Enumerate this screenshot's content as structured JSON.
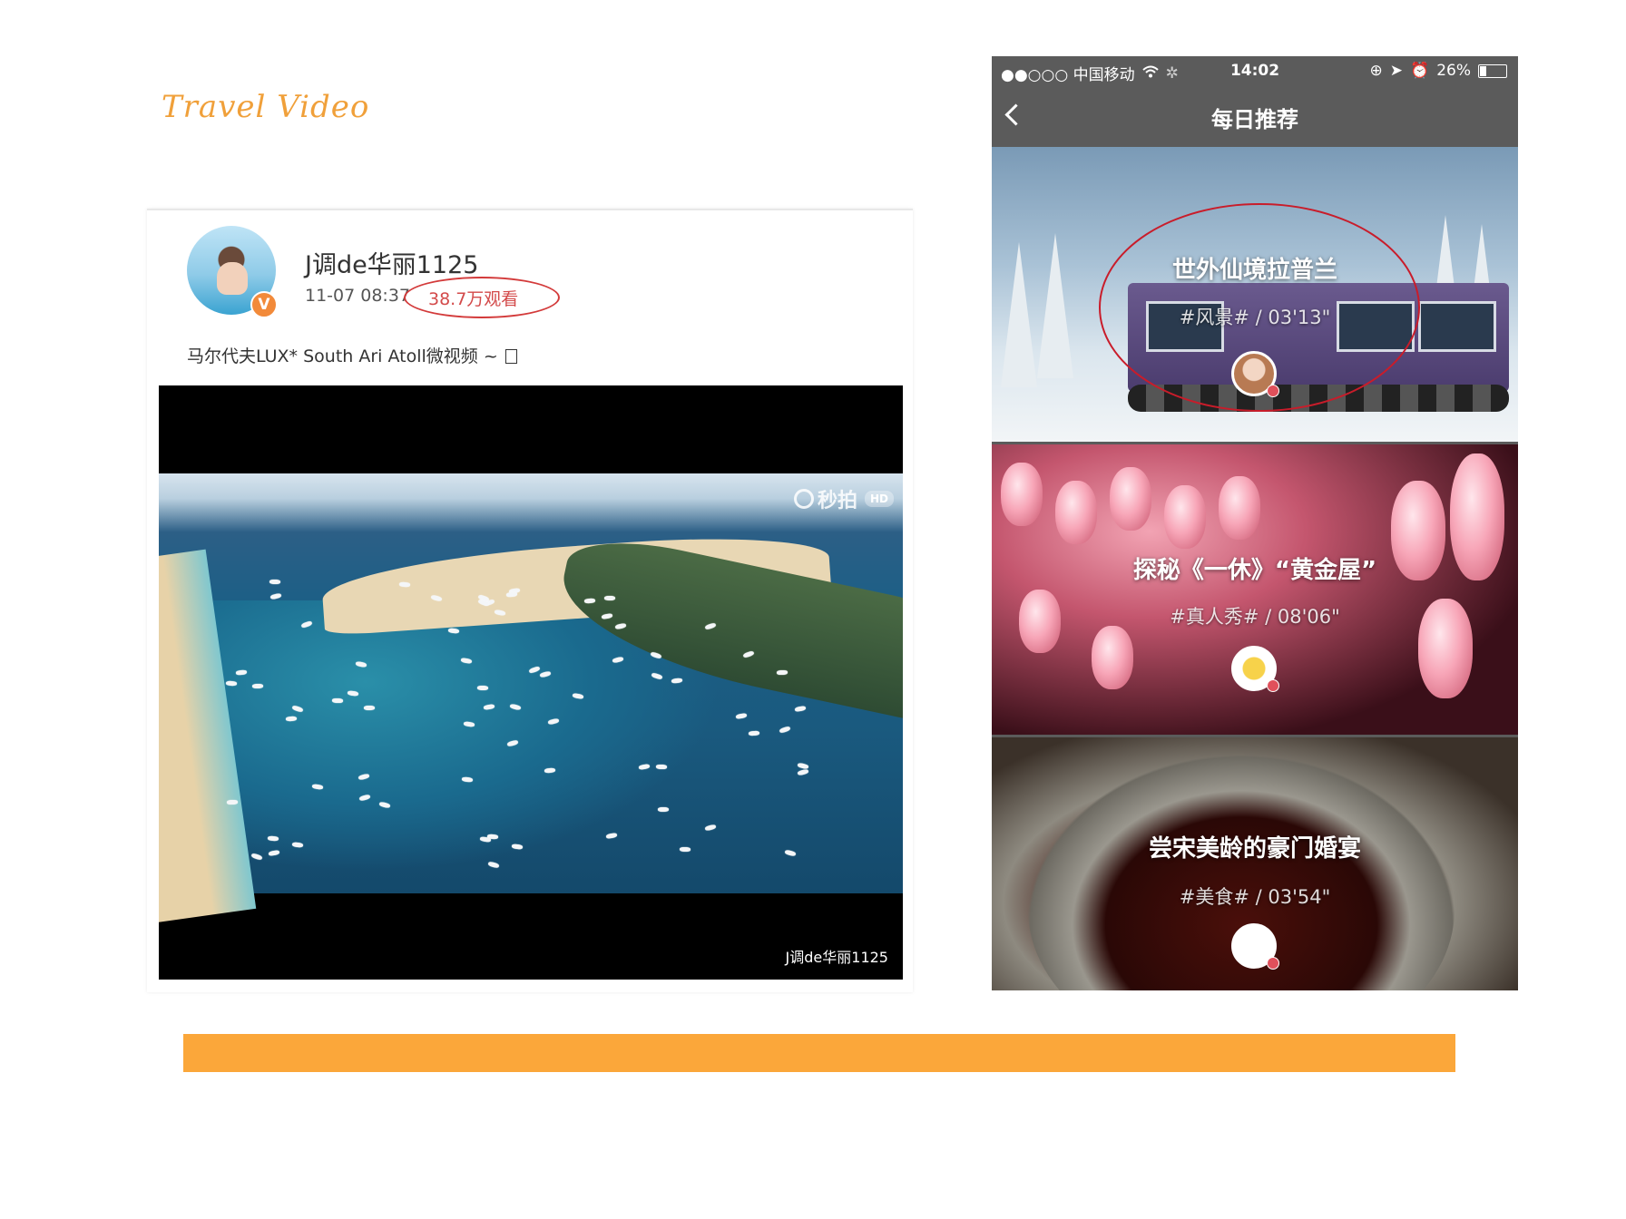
{
  "slide": {
    "title": "Travel Video",
    "accent_color": "#fba73a"
  },
  "weibo_post": {
    "username": "J调de华丽1125",
    "time": "11-07 08:37",
    "views": "38.7万观看",
    "text": "马尔代夫LUX* South Ari Atoll微视频 ~ ",
    "verified_icon": "verified-v-icon",
    "video": {
      "watermark": "秒拍",
      "quality_badge": "HD",
      "credit": "J调de华丽1125"
    }
  },
  "phone": {
    "status_bar": {
      "carrier": "●●○○○ 中国移动",
      "time": "14:02",
      "battery": "26%"
    },
    "nav_title": "每日推荐",
    "cards": [
      {
        "title": "世外仙境拉普兰",
        "meta": "#风景# / 03'13\""
      },
      {
        "title": "探秘《一休》“黄金屋”",
        "meta": "#真人秀# / 08'06\""
      },
      {
        "title": "尝宋美龄的豪门婚宴",
        "meta": "#美食# / 03'54\""
      }
    ]
  }
}
